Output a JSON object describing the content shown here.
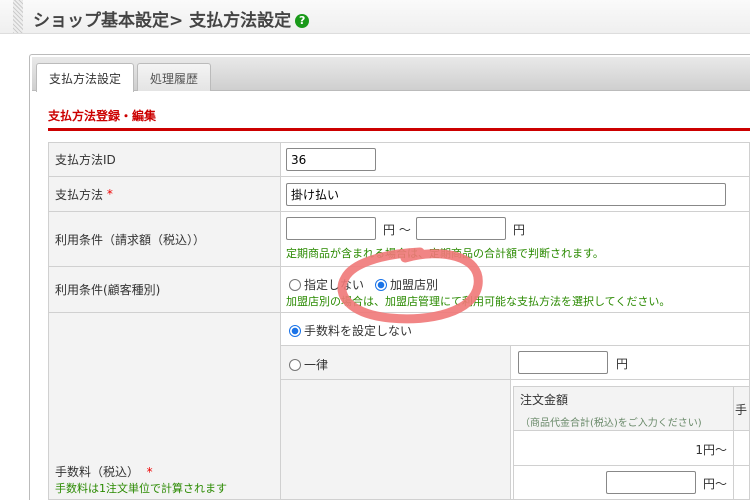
{
  "header": {
    "title": "ショップ基本設定> 支払方法設定",
    "help_icon": "?"
  },
  "tabs": [
    {
      "label": "支払方法設定",
      "active": true
    },
    {
      "label": "処理履歴",
      "active": false
    }
  ],
  "section_title": "支払方法登録・編集",
  "form": {
    "id_label": "支払方法ID",
    "id_value": "36",
    "method_label": "支払方法",
    "required_mark": "*",
    "method_value": "掛け払い",
    "cond_amount_label": "利用条件（請求額（税込））",
    "yen": "円",
    "tilde_yen": "円 ～",
    "cond_amount_note": "定期商品が含まれる場合は、定期商品の合計額で判断されます。",
    "cond_customer_label": "利用条件(顧客種別)",
    "opt_none": "指定しない",
    "opt_merchant": "加盟店別",
    "cond_customer_note": "加盟店別の場合は、加盟店管理にて利用可能な支払方法を選択してください。",
    "fee_label": "手数料（税込）",
    "fee_note": "手数料は1注文単位で計算されます",
    "fee_opt_none": "手数料を設定しない",
    "fee_opt_flat": "一律",
    "order_amount_header": "注文金額",
    "order_amount_hint": "（商品代金合計(税込)をご入力ください)",
    "fee_col_header": "手",
    "row1_amount": "1円～",
    "row2_suffix": "円～"
  },
  "colors": {
    "accent": "#cc0000",
    "note": "#2a8a00",
    "annotation": "#f07878"
  }
}
